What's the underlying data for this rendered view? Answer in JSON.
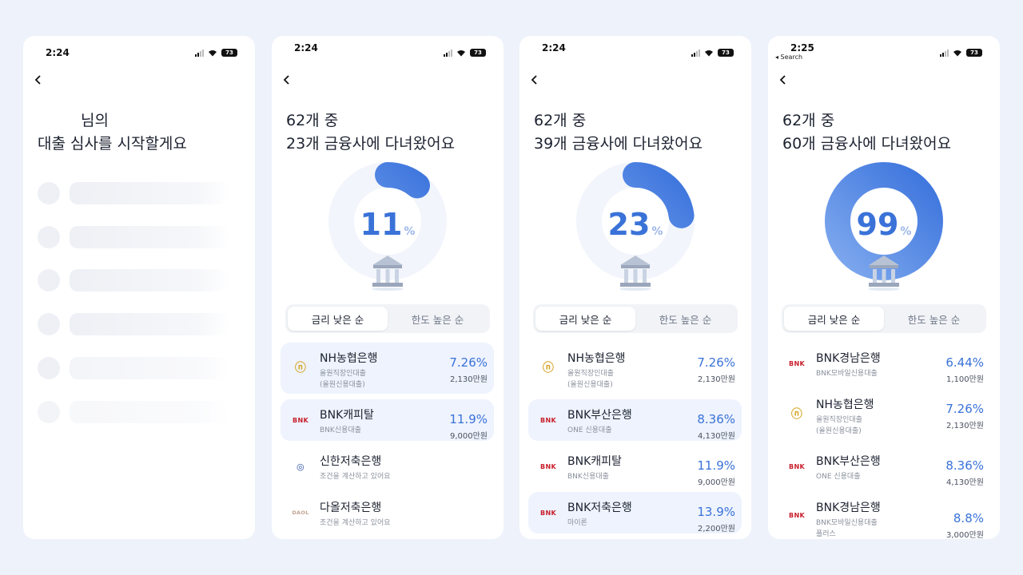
{
  "status": {
    "battery": "73",
    "search_label": "◂ Search"
  },
  "screens": [
    {
      "time": "2:24",
      "title_line1": "님의",
      "title_line2": "대출 심사를 시작할게요"
    },
    {
      "time": "2:24",
      "title_line1": "62개 중",
      "title_line2": "23개 금융사에 다녀왔어요",
      "percent": "11",
      "percent_sign": "%",
      "progress_fraction": 0.11,
      "tabs": [
        "금리 낮은 순",
        "한도 높은 순"
      ],
      "items": [
        {
          "logo": "NH",
          "name": "NH농협은행",
          "sub1": "올원직장인대출",
          "sub2": "(올원신용대출)",
          "rate": "7.26%",
          "limit": "2,130만원"
        },
        {
          "logo": "BNK",
          "name": "BNK캐피탈",
          "sub1": "BNK신용대출",
          "sub2": "",
          "rate": "11.9%",
          "limit": "9,000만원"
        },
        {
          "logo": "SH",
          "name": "신한저축은행",
          "sub1": "조건을 계산하고 있어요",
          "sub2": "",
          "rate": "",
          "limit": ""
        },
        {
          "logo": "DAOL",
          "name": "다올저축은행",
          "sub1": "조건을 계산하고 있어요",
          "sub2": "",
          "rate": "",
          "limit": ""
        }
      ]
    },
    {
      "time": "2:24",
      "title_line1": "62개 중",
      "title_line2": "39개 금융사에 다녀왔어요",
      "percent": "23",
      "percent_sign": "%",
      "progress_fraction": 0.23,
      "tabs": [
        "금리 낮은 순",
        "한도 높은 순"
      ],
      "items": [
        {
          "logo": "NH",
          "name": "NH농협은행",
          "sub1": "올원직장인대출",
          "sub2": "(올원신용대출)",
          "rate": "7.26%",
          "limit": "2,130만원"
        },
        {
          "logo": "BNK",
          "name": "BNK부산은행",
          "sub1": "ONE 신용대출",
          "sub2": "",
          "rate": "8.36%",
          "limit": "4,130만원"
        },
        {
          "logo": "BNK",
          "name": "BNK캐피탈",
          "sub1": "BNK신용대출",
          "sub2": "",
          "rate": "11.9%",
          "limit": "9,000만원"
        },
        {
          "logo": "BNK",
          "name": "BNK저축은행",
          "sub1": "마이론",
          "sub2": "",
          "rate": "13.9%",
          "limit": "2,200만원"
        }
      ]
    },
    {
      "time": "2:25",
      "title_line1": "62개 중",
      "title_line2": "60개 금융사에 다녀왔어요",
      "percent": "99",
      "percent_sign": "%",
      "progress_fraction": 0.99,
      "tabs": [
        "금리 낮은 순",
        "한도 높은 순"
      ],
      "items": [
        {
          "logo": "BNK",
          "name": "BNK경남은행",
          "sub1": "BNK모바일신용대출",
          "sub2": "",
          "rate": "6.44%",
          "limit": "1,100만원"
        },
        {
          "logo": "NH",
          "name": "NH농협은행",
          "sub1": "올원직장인대출",
          "sub2": "(올원신용대출)",
          "rate": "7.26%",
          "limit": "2,130만원"
        },
        {
          "logo": "BNK",
          "name": "BNK부산은행",
          "sub1": "ONE 신용대출",
          "sub2": "",
          "rate": "8.36%",
          "limit": "4,130만원"
        },
        {
          "logo": "BNK",
          "name": "BNK경남은행",
          "sub1": "BNK모바일신용대출",
          "sub2": "플러스",
          "rate": "8.8%",
          "limit": "3,000만원"
        }
      ]
    }
  ],
  "colors": {
    "accent": "#3a72d8",
    "highlight_row": "#eef3fd",
    "page_bg": "#eef2fa"
  }
}
